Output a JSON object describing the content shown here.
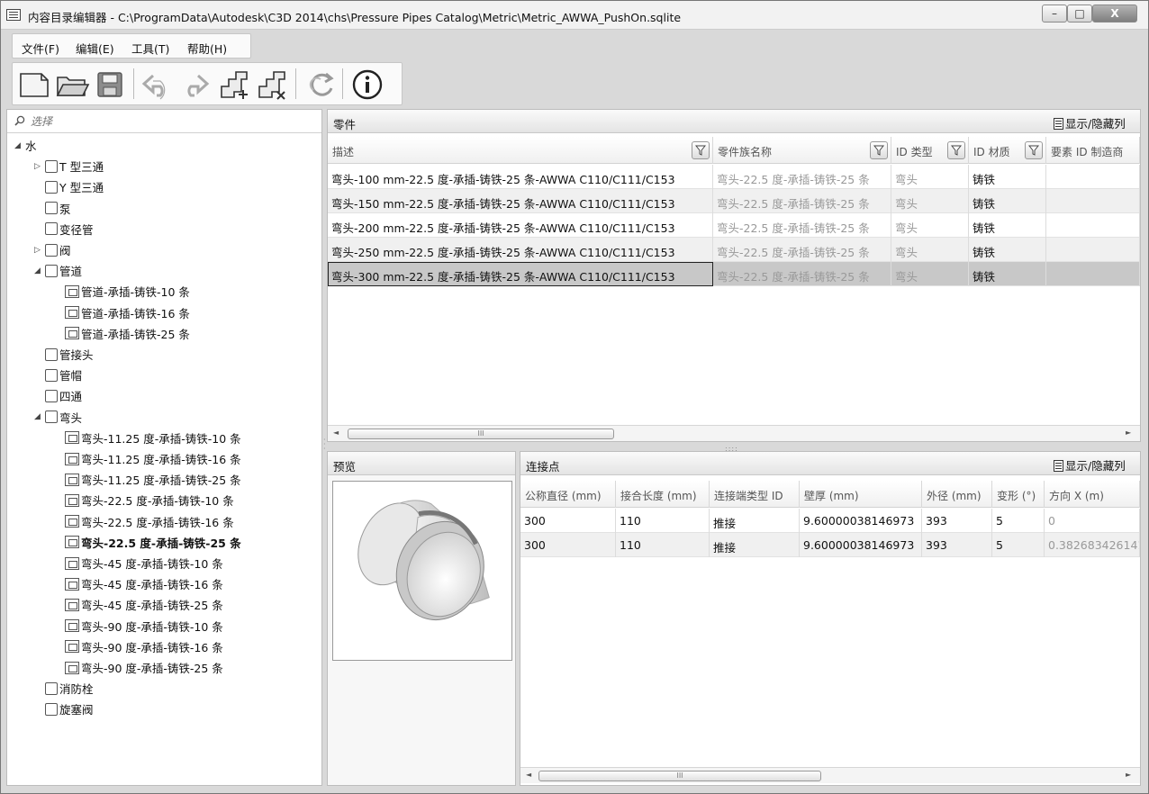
{
  "window": {
    "title": "内容目录编辑器 - C:\\ProgramData\\Autodesk\\C3D 2014\\chs\\Pressure Pipes Catalog\\Metric\\Metric_AWWA_PushOn.sqlite",
    "minimize_glyph": "–",
    "maximize_glyph": "□",
    "close_glyph": "X"
  },
  "menu": {
    "items": [
      "文件(F)",
      "编辑(E)",
      "工具(T)",
      "帮助(H)"
    ]
  },
  "toolbar": {
    "buttons": [
      "new-icon",
      "open-icon",
      "save-icon",
      "undo-icon",
      "redo-icon",
      "add-part-icon",
      "delete-part-icon",
      "refresh-icon",
      "info-icon"
    ]
  },
  "search": {
    "placeholder": "选择"
  },
  "tree": [
    {
      "label": "水",
      "level": 0,
      "toggle": "◢",
      "icon": "none"
    },
    {
      "label": "T 型三通",
      "level": 1,
      "toggle": "▷",
      "icon": "folder"
    },
    {
      "label": "Y 型三通",
      "level": 1,
      "toggle": "",
      "icon": "folder"
    },
    {
      "label": "泵",
      "level": 1,
      "toggle": "",
      "icon": "folder"
    },
    {
      "label": "变径管",
      "level": 1,
      "toggle": "",
      "icon": "folder"
    },
    {
      "label": "阀",
      "level": 1,
      "toggle": "▷",
      "icon": "folder"
    },
    {
      "label": "管道",
      "level": 1,
      "toggle": "◢",
      "icon": "folder"
    },
    {
      "label": "管道-承插-铸铁-10 条",
      "level": 2,
      "toggle": "",
      "icon": "part"
    },
    {
      "label": "管道-承插-铸铁-16 条",
      "level": 2,
      "toggle": "",
      "icon": "part"
    },
    {
      "label": "管道-承插-铸铁-25 条",
      "level": 2,
      "toggle": "",
      "icon": "part"
    },
    {
      "label": "管接头",
      "level": 1,
      "toggle": "",
      "icon": "folder"
    },
    {
      "label": "管帽",
      "level": 1,
      "toggle": "",
      "icon": "folder"
    },
    {
      "label": "四通",
      "level": 1,
      "toggle": "",
      "icon": "folder"
    },
    {
      "label": "弯头",
      "level": 1,
      "toggle": "◢",
      "icon": "folder"
    },
    {
      "label": "弯头-11.25 度-承插-铸铁-10 条",
      "level": 2,
      "toggle": "",
      "icon": "part"
    },
    {
      "label": "弯头-11.25 度-承插-铸铁-16 条",
      "level": 2,
      "toggle": "",
      "icon": "part"
    },
    {
      "label": "弯头-11.25 度-承插-铸铁-25 条",
      "level": 2,
      "toggle": "",
      "icon": "part"
    },
    {
      "label": "弯头-22.5 度-承插-铸铁-10 条",
      "level": 2,
      "toggle": "",
      "icon": "part"
    },
    {
      "label": "弯头-22.5 度-承插-铸铁-16 条",
      "level": 2,
      "toggle": "",
      "icon": "part"
    },
    {
      "label": "弯头-22.5 度-承插-铸铁-25 条",
      "level": 2,
      "toggle": "",
      "icon": "part",
      "selected": true
    },
    {
      "label": "弯头-45 度-承插-铸铁-10 条",
      "level": 2,
      "toggle": "",
      "icon": "part"
    },
    {
      "label": "弯头-45 度-承插-铸铁-16 条",
      "level": 2,
      "toggle": "",
      "icon": "part"
    },
    {
      "label": "弯头-45 度-承插-铸铁-25 条",
      "level": 2,
      "toggle": "",
      "icon": "part"
    },
    {
      "label": "弯头-90 度-承插-铸铁-10 条",
      "level": 2,
      "toggle": "",
      "icon": "part"
    },
    {
      "label": "弯头-90 度-承插-铸铁-16 条",
      "level": 2,
      "toggle": "",
      "icon": "part"
    },
    {
      "label": "弯头-90 度-承插-铸铁-25 条",
      "level": 2,
      "toggle": "",
      "icon": "part"
    },
    {
      "label": "消防栓",
      "level": 1,
      "toggle": "",
      "icon": "folder"
    },
    {
      "label": "旋塞阀",
      "level": 1,
      "toggle": "",
      "icon": "folder"
    }
  ],
  "parts": {
    "title": "零件",
    "show_hide": "显示/隐藏列",
    "columns": [
      "描述",
      "零件族名称",
      "ID 类型",
      "ID 材质",
      "要素 ID 制造商"
    ],
    "rows": [
      [
        "弯头-100 mm-22.5 度-承插-铸铁-25 条-AWWA C110/C111/C153",
        "弯头-22.5 度-承插-铸铁-25 条",
        "弯头",
        "铸铁",
        ""
      ],
      [
        "弯头-150 mm-22.5 度-承插-铸铁-25 条-AWWA C110/C111/C153",
        "弯头-22.5 度-承插-铸铁-25 条",
        "弯头",
        "铸铁",
        ""
      ],
      [
        "弯头-200 mm-22.5 度-承插-铸铁-25 条-AWWA C110/C111/C153",
        "弯头-22.5 度-承插-铸铁-25 条",
        "弯头",
        "铸铁",
        ""
      ],
      [
        "弯头-250 mm-22.5 度-承插-铸铁-25 条-AWWA C110/C111/C153",
        "弯头-22.5 度-承插-铸铁-25 条",
        "弯头",
        "铸铁",
        ""
      ],
      [
        "弯头-300 mm-22.5 度-承插-铸铁-25 条-AWWA C110/C111/C153",
        "弯头-22.5 度-承插-铸铁-25 条",
        "弯头",
        "铸铁",
        ""
      ]
    ],
    "selected_row": 4,
    "scroll_thumb": "III"
  },
  "preview": {
    "title": "预览"
  },
  "connections": {
    "title": "连接点",
    "show_hide": "显示/隐藏列",
    "columns": [
      "公称直径 (mm)",
      "接合长度 (mm)",
      "连接端类型 ID",
      "壁厚 (mm)",
      "外径 (mm)",
      "变形 (°)",
      "方向 X (m)"
    ],
    "rows": [
      [
        "300",
        "110",
        "推接",
        "9.60000038146973",
        "393",
        "5",
        "0"
      ],
      [
        "300",
        "110",
        "推接",
        "9.60000038146973",
        "393",
        "5",
        "0.382683426141"
      ]
    ],
    "scroll_thumb": "III"
  }
}
